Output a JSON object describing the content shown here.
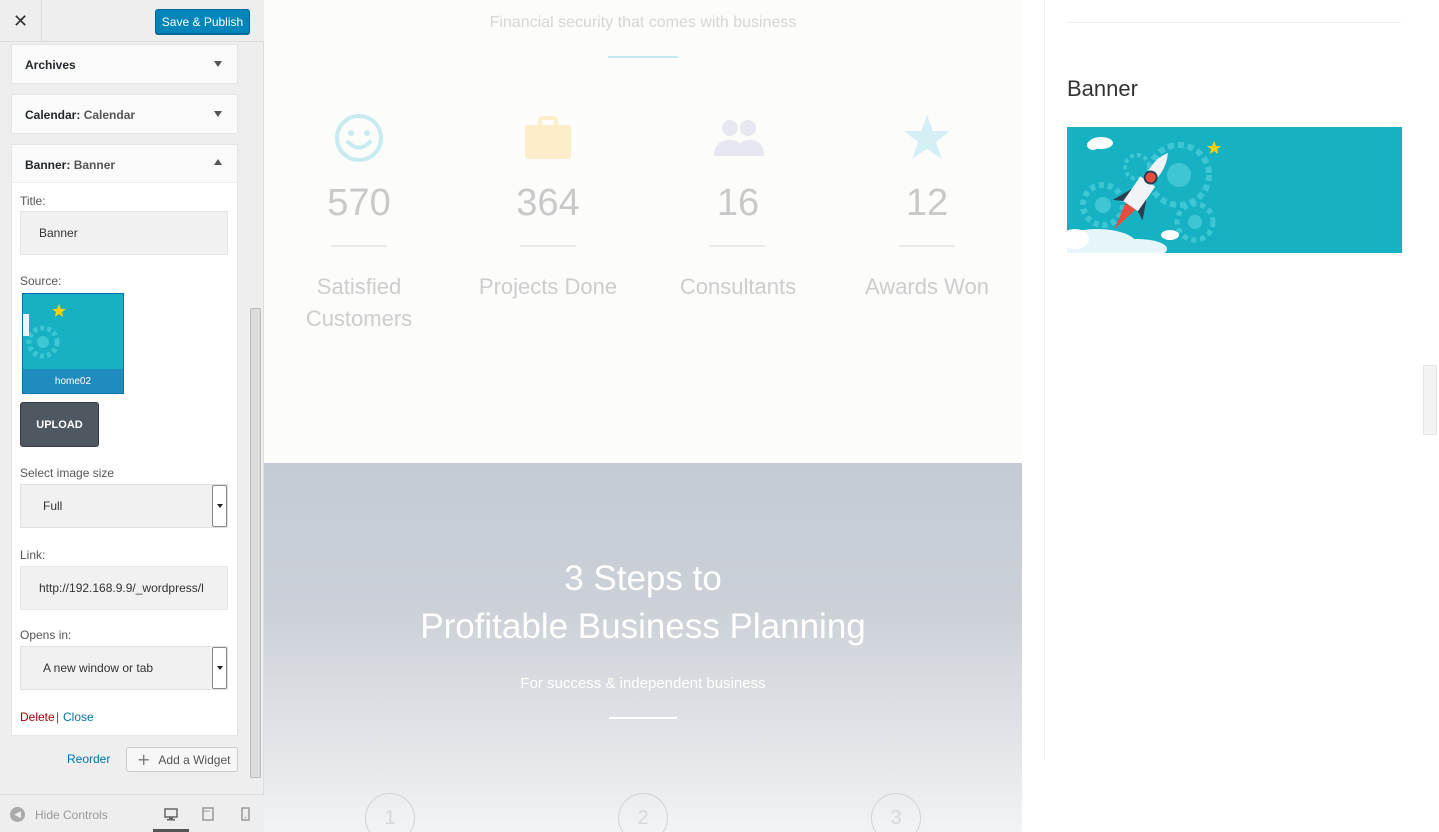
{
  "header": {
    "close_icon": "close-icon",
    "save_label": "Save & Publish"
  },
  "widgets": {
    "archives": {
      "name": "Archives"
    },
    "calendar": {
      "name": "Calendar:",
      "title": "Calendar"
    },
    "banner": {
      "name": "Banner:",
      "title": "Banner"
    }
  },
  "form": {
    "title_label": "Title:",
    "title_value": "Banner",
    "source_label": "Source:",
    "source_filename": "home02",
    "upload_label": "UPLOAD",
    "size_label": "Select image size",
    "size_value": "Full",
    "link_label": "Link:",
    "link_value": "http://192.168.9.9/_wordpress/l",
    "opens_label": "Opens in:",
    "opens_value": "A new window or tab",
    "delete_label": "Delete",
    "separator": "|",
    "close_label": "Close"
  },
  "footer": {
    "reorder_label": "Reorder",
    "add_widget_label": "Add a Widget",
    "hide_controls_label": "Hide Controls",
    "devices": [
      "desktop-icon",
      "tablet-icon",
      "mobile-icon"
    ]
  },
  "preview": {
    "stats_subtitle": "Financial security that comes with business",
    "stats": [
      {
        "icon": "smiley-icon",
        "number": "570",
        "label": "Satisfied Customers"
      },
      {
        "icon": "briefcase-icon",
        "number": "364",
        "label": "Projects Done"
      },
      {
        "icon": "users-icon",
        "number": "16",
        "label": "Consultants"
      },
      {
        "icon": "star-icon",
        "number": "12",
        "label": "Awards Won"
      }
    ],
    "steps_title_1": "3 Steps to",
    "steps_title_2": "Profitable Business Planning",
    "steps_subtitle": "For success & independent business",
    "step_numbers": [
      "1",
      "2",
      "3"
    ],
    "sidebar_widget_title": "Banner"
  },
  "colors": {
    "primary": "#0085ba",
    "banner_bg": "#16b2c4",
    "delete": "#aa0000",
    "link": "#0073aa"
  }
}
